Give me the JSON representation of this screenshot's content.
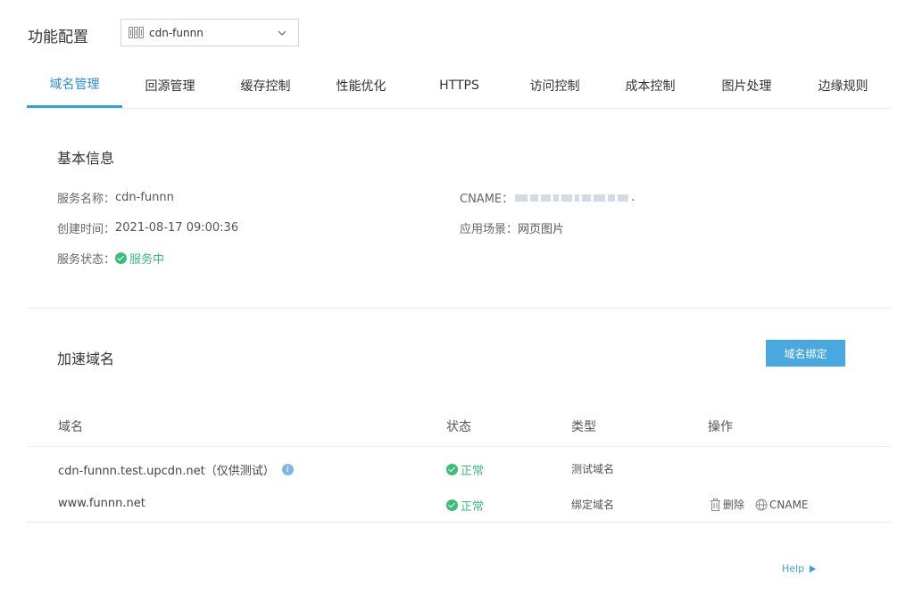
{
  "header": {
    "title": "功能配置",
    "service_select": {
      "value": "cdn-funnn",
      "icon": "service-icon"
    }
  },
  "tabs": [
    {
      "label": "域名管理",
      "active": true
    },
    {
      "label": "回源管理"
    },
    {
      "label": "缓存控制"
    },
    {
      "label": "性能优化"
    },
    {
      "label": "HTTPS"
    },
    {
      "label": "访问控制"
    },
    {
      "label": "成本控制"
    },
    {
      "label": "图片处理"
    },
    {
      "label": "边缘规则"
    }
  ],
  "basic_info": {
    "title": "基本信息",
    "service_name_label": "服务名称：",
    "service_name": "cdn-funnn",
    "created_label": "创建时间：",
    "created": "2021-08-17 09:00:36",
    "status_label": "服务状态：",
    "status": "服务中",
    "cname_label": "CNAME：",
    "cname_suffix": ".",
    "scene_label": "应用场景：",
    "scene": "网页图片"
  },
  "domains": {
    "title": "加速域名",
    "bind_button": "域名绑定",
    "columns": [
      "域名",
      "状态",
      "类型",
      "操作"
    ],
    "rows": [
      {
        "domain": "cdn-funnn.test.upcdn.net（仅供测试）",
        "status": "正常",
        "type": "测试域名",
        "ops": []
      },
      {
        "domain": "www.funnn.net",
        "status": "正常",
        "type": "绑定域名",
        "ops": [
          "删除",
          "CNAME"
        ]
      }
    ]
  },
  "footer": {
    "help": "Help"
  },
  "colors": {
    "accent": "#3a9fe0",
    "success": "#3bbd7a",
    "button": "#4aa8e0"
  }
}
